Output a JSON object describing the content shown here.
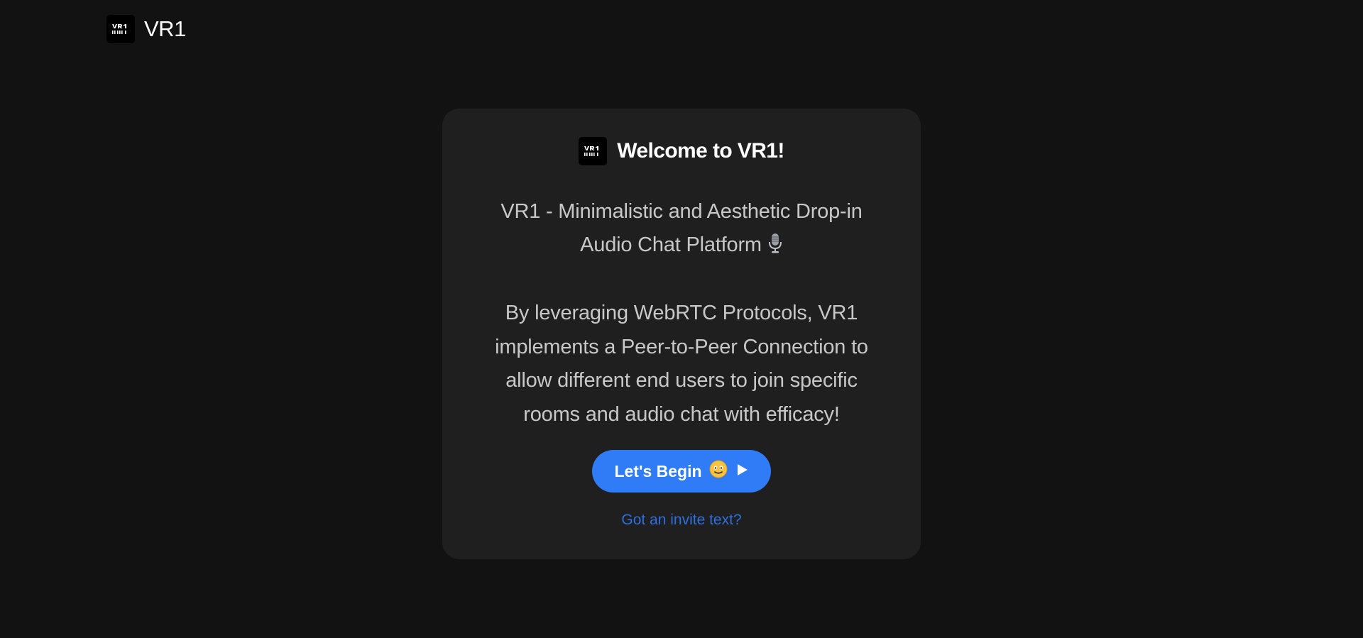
{
  "navbar": {
    "logo_text": "VR1",
    "brand_name": "VR1"
  },
  "card": {
    "logo_text": "VR1",
    "title": "Welcome to VR1!",
    "tagline": "VR1 - Minimalistic and Aesthetic Drop-in Audio Chat Platform",
    "tagline_icon": "microphone-icon",
    "description": "By leveraging WebRTC Protocols, VR1 implements a Peer-to-Peer Connection to allow different end users to join specific rooms and audio chat with efficacy!",
    "begin_button_label": "Let's Begin",
    "begin_button_icons": [
      "smiling-face-icon",
      "play-icon"
    ],
    "invite_link": "Got an invite text?"
  },
  "colors": {
    "background": "#121212",
    "card_background": "#1f1f1f",
    "accent": "#2f7cf6",
    "link": "#2f6fe0",
    "text_muted": "#c8c8c8"
  }
}
